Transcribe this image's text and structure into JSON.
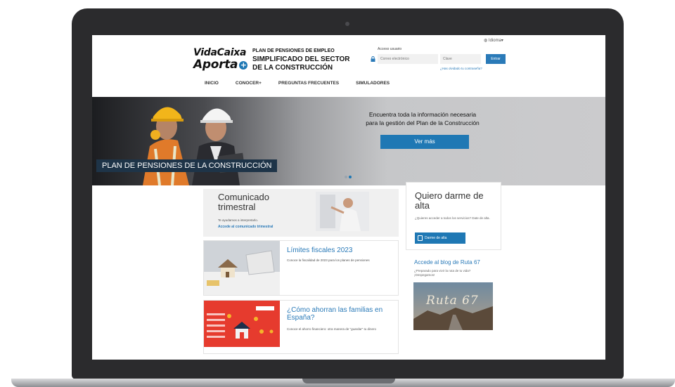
{
  "header": {
    "language_link": "Idioma",
    "logo": {
      "line1": "VidaCaixa",
      "line2": "Aporta"
    },
    "plan_title": {
      "line1": "PLAN DE PENSIONES DE EMPLEO",
      "line2": "SIMPLIFICADO DEL SECTOR",
      "line3": "DE LA CONSTRUCCIÓN"
    },
    "login": {
      "label": "Acceso usuario",
      "email_placeholder": "Correo electrónico",
      "password_placeholder": "Clave",
      "submit": "Entrar",
      "forgot": "¿Has olvidado tu contraseña?"
    }
  },
  "nav": {
    "items": [
      {
        "label": "INICIO"
      },
      {
        "label": "CONOCER+"
      },
      {
        "label": "PREGUNTAS FRECUENTES"
      },
      {
        "label": "SIMULADORES"
      }
    ]
  },
  "hero": {
    "banner": "PLAN DE PENSIONES DE LA CONSTRUCCIÓN",
    "text_line1": "Encuentra toda la información necesaria",
    "text_line2": "para la gestión del Plan de la Construcción",
    "button": "Ver más",
    "slide_count": 2,
    "active_slide": 2
  },
  "cards": {
    "comunicado": {
      "title": "Comunicado trimestral",
      "subtitle": "Te ayudamos a interpretarlo.",
      "link": "Accede al comunicado trimestral"
    },
    "alta": {
      "title": "Quiero darme de alta",
      "subtitle": "¿Quieres acceder a todos los servicios? Date de alta.",
      "button": "Darme de alta"
    },
    "limites": {
      "title": "Límites fiscales 2023",
      "subtitle": "Conoce la fiscalidad de 2023 para los planes de pensiones"
    },
    "familias": {
      "title": "¿Cómo ahorran las familias en España?",
      "subtitle": "Conoce el ahorro financiero: otra manera de \"guardar\" tu dinero"
    },
    "blog": {
      "title": "Accede al blog de Ruta 67",
      "subtitle": "¿Preparado para vivir la ruta de tu vida? ¡Despegamos!",
      "image_text": "Ruta 67"
    }
  },
  "colors": {
    "accent": "#1f78b4",
    "banner_bg": "#1e3448",
    "frame": "#2b2b2d"
  }
}
